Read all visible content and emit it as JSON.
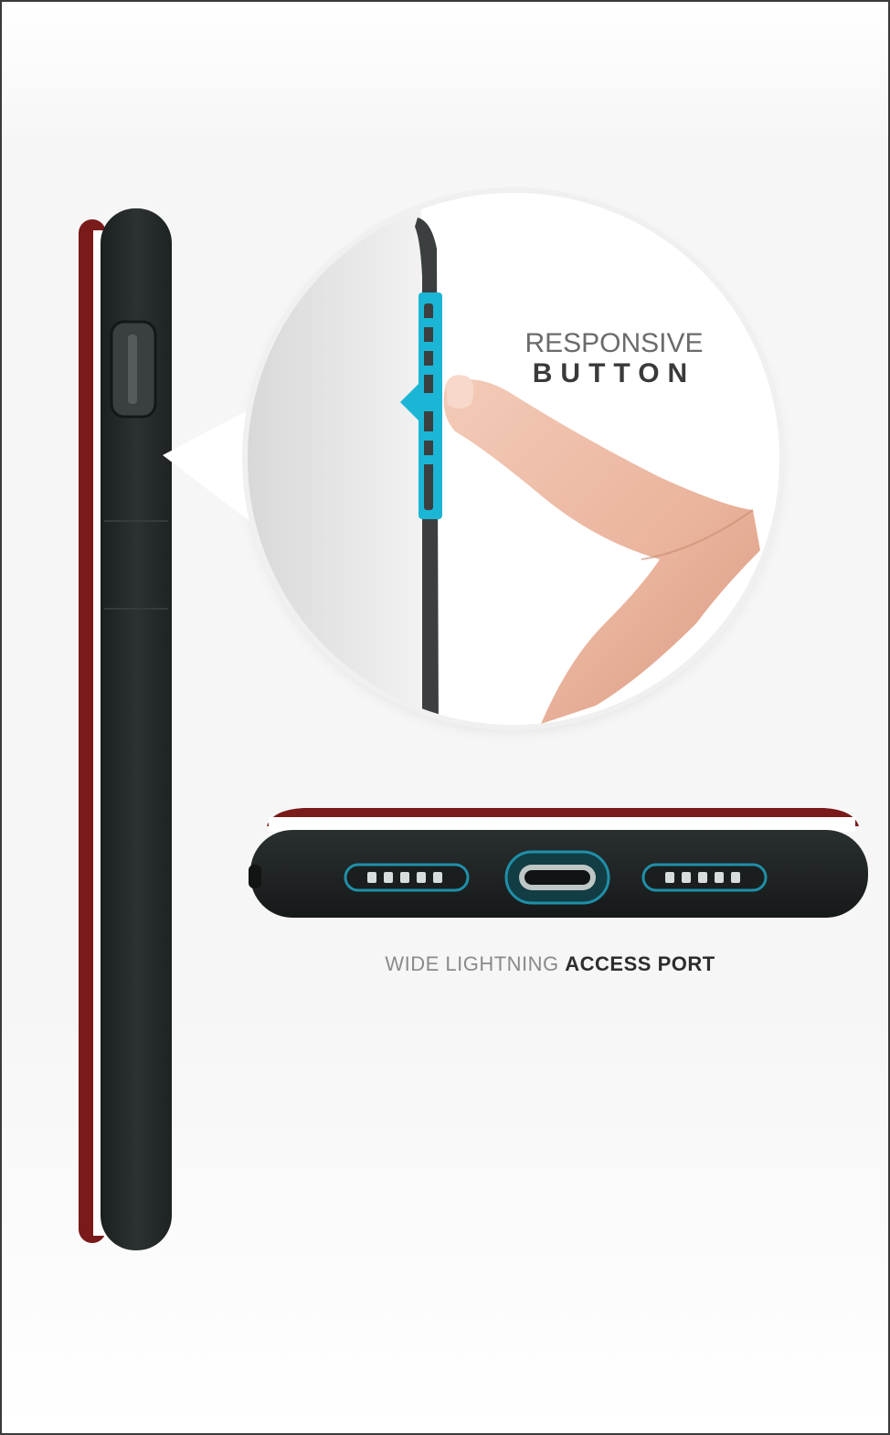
{
  "responsive_button": {
    "line1": "RESPONSIVE",
    "line2": "BUTTON"
  },
  "access_port": {
    "light_text": "WIDE LIGHTNING ",
    "bold_text": "ACCESS PORT"
  },
  "colors": {
    "case_black": "#262a2a",
    "case_red": "#7a1a1a",
    "highlight_cyan": "#1bb6d6"
  }
}
